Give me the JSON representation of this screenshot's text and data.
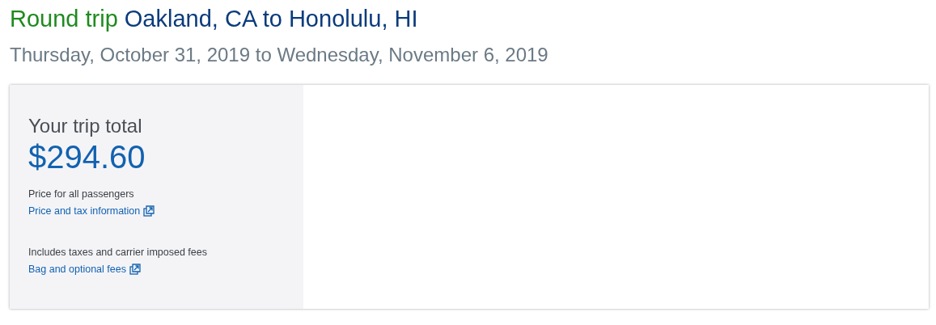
{
  "heading": {
    "trip_type": "Round trip",
    "route": "Oakland, CA to Honolulu, HI"
  },
  "dates": "Thursday, October 31, 2019 to Wednesday, November 6, 2019",
  "summary": {
    "label": "Your trip total",
    "total": "$294.60",
    "notes": [
      {
        "text": "Price for all passengers",
        "link": "Price and tax information"
      },
      {
        "text": "Includes taxes and carrier imposed fees",
        "link": "Bag and optional fees"
      }
    ]
  }
}
